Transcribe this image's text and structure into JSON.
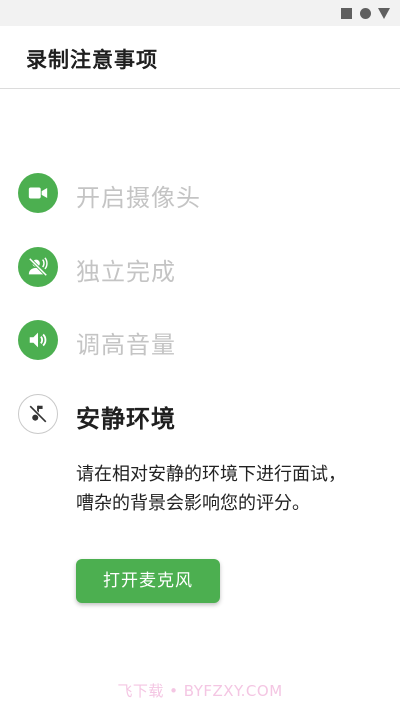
{
  "header": {
    "title": "录制注意事项"
  },
  "steps": [
    {
      "label": "开启摄像头",
      "icon": "video-camera-icon",
      "state": "done"
    },
    {
      "label": "独立完成",
      "icon": "no-voice-icon",
      "state": "done"
    },
    {
      "label": "调高音量",
      "icon": "volume-icon",
      "state": "done"
    },
    {
      "label": "安静环境",
      "icon": "music-off-icon",
      "state": "current"
    }
  ],
  "description": "请在相对安静的环境下进行面试，嘈杂的背景会影响您的评分。",
  "actions": {
    "open_mic_label": "打开麦克风"
  },
  "watermark": "飞下载 • BYFZXY.COM",
  "colors": {
    "accent": "#4caf50",
    "inactive_text": "#c4c4c4"
  }
}
